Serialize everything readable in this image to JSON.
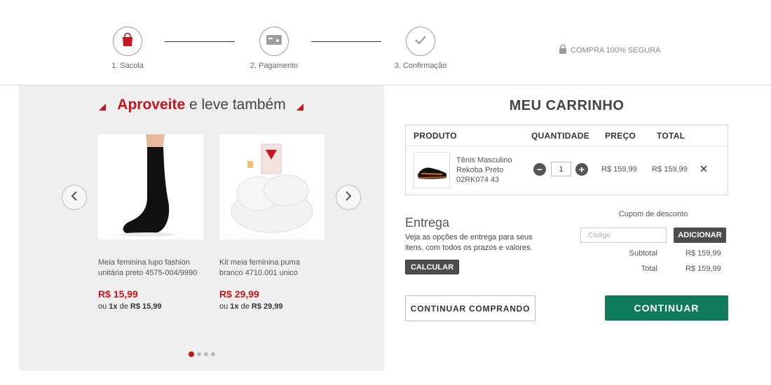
{
  "steps": [
    {
      "label": "1. Sacola",
      "icon": "shopping-bag-icon"
    },
    {
      "label": "2. Pagamento",
      "icon": "credit-card-icon"
    },
    {
      "label": "3. Confirmação",
      "icon": "checkmark-icon"
    }
  ],
  "secure_label": "COMPRA 100% SEGURA",
  "upsell": {
    "title_highlight": "Aproveite",
    "title_rest": " e leve também",
    "products": [
      {
        "name": "Meia feminina lupo fashion unitária preto 4575-004/9990",
        "price": "R$ 15,99",
        "install_prefix": "ou ",
        "install_count": "1x",
        "install_mid": " de ",
        "install_value": "R$ 15,99"
      },
      {
        "name": "Kit meia feminina puma branco 4710.001 unico",
        "price": "R$ 29,99",
        "install_prefix": "ou ",
        "install_count": "1x",
        "install_mid": " de ",
        "install_value": "R$ 29,99"
      }
    ],
    "dots_total": 4,
    "dots_active": 1
  },
  "cart": {
    "title": "MEU CARRINHO",
    "headers": {
      "product": "PRODUTO",
      "quantity": "QUANTIDADE",
      "price": "PREÇO",
      "total": "TOTAL"
    },
    "items": [
      {
        "name": "Tênis Masculino Rekoba Preto 02RK074 43",
        "quantity": "1",
        "price": "R$ 159,99",
        "total": "R$ 159,99"
      }
    ]
  },
  "delivery": {
    "title": "Entrega",
    "text": "Veja as opções de entrega para seus itens, com todos os prazos e valores.",
    "button": "CALCULAR"
  },
  "coupon": {
    "label": "Cupom de desconto",
    "placeholder": "Código",
    "button": "ADICIONAR"
  },
  "summary": {
    "subtotal_label": "Subtotal",
    "subtotal_value": "R$ 159,99",
    "total_label": "Total",
    "total_value": "R$ 159,99"
  },
  "actions": {
    "continue_shopping": "CONTINUAR COMPRANDO",
    "continue": "CONTINUAR"
  },
  "colors": {
    "accent": "#c4161c",
    "primary": "#0f7b5a",
    "dark_button": "#4d4d4d"
  }
}
